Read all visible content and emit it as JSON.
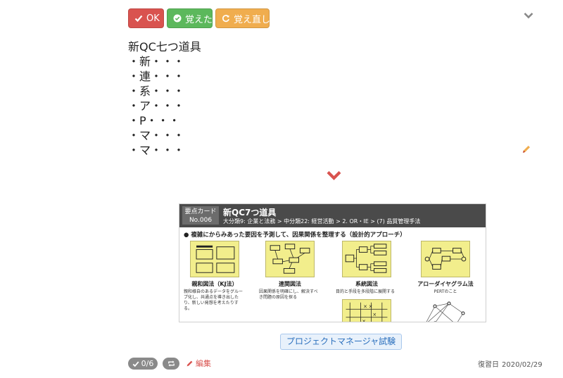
{
  "toolbar": {
    "ok_label": "OK",
    "remember_label": "覚えた",
    "relearn_label": "覚え直し",
    "colors": {
      "ok": "#d9534f",
      "remember": "#5cb85c",
      "relearn": "#f0ad4e"
    }
  },
  "card": {
    "lines": [
      "新QC七つ道具",
      "・新・・・",
      "・連・・・",
      "・系・・・",
      "・ア・・・",
      "・P・・・",
      "・マ・・・",
      "・マ・・・"
    ]
  },
  "image": {
    "badge_line1": "要点カード",
    "badge_line2": "No.006",
    "title": "新QC7つ道具",
    "breadcrumb": "大分類9: 企業と法務 > 中分類22: 経営活動 > 2. OR・IE > (7) 品質管理手法",
    "subtitle": "● 複雑にからみあった要因を予測して、因果関係を整理する（設計的アプローチ）",
    "tools": [
      {
        "name": "親和図法（KJ法）",
        "desc": "親和様自のあるデータをグループ化し、共通点を導き出したり、新しい発想を考えたりする。"
      },
      {
        "name": "連関図法",
        "desc": "因果関係を明確にし、解決すべき問題の原因を探る"
      },
      {
        "name": "系統図法",
        "desc": "目的と手段を多段階に展開する"
      },
      {
        "name": "アローダイヤグラム法",
        "desc": "PERTのこと"
      }
    ]
  },
  "tag": {
    "label": "プロジェクトマネージャ試験"
  },
  "footer": {
    "progress": "0/6",
    "edit_label": "編集",
    "review_label": "復習日",
    "review_date": "2020/02/29"
  },
  "icons": [
    "check-icon",
    "check-circle-icon",
    "refresh-icon",
    "chevron-down-icon",
    "pencil-icon",
    "repeat-icon"
  ]
}
